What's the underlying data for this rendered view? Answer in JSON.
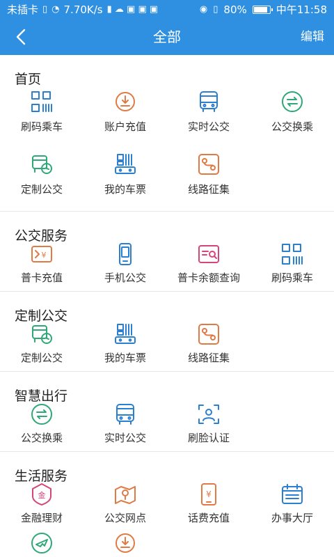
{
  "status": {
    "carrier": "未插卡",
    "speed": "7.70K/s",
    "battery": "80%",
    "time": "中午11:58"
  },
  "header": {
    "title": "全部",
    "edit": "编辑"
  },
  "sections": [
    {
      "title": "首页",
      "items": [
        {
          "label": "刷码乘车",
          "icon": "qr-scan-icon"
        },
        {
          "label": "账户充值",
          "icon": "download-coin-icon"
        },
        {
          "label": "实时公交",
          "icon": "bus-icon"
        },
        {
          "label": "公交换乘",
          "icon": "transfer-icon"
        },
        {
          "label": "定制公交",
          "icon": "custom-bus-icon"
        },
        {
          "label": "我的车票",
          "icon": "ticket-icon"
        },
        {
          "label": "线路征集",
          "icon": "route-map-icon"
        }
      ]
    },
    {
      "title": "公交服务",
      "items": [
        {
          "label": "普卡充值",
          "icon": "card-recharge-icon"
        },
        {
          "label": "手机公交",
          "icon": "phone-icon"
        },
        {
          "label": "普卡余额查询",
          "icon": "balance-query-icon"
        },
        {
          "label": "刷码乘车",
          "icon": "qr-scan-icon"
        }
      ]
    },
    {
      "title": "定制公交",
      "items": [
        {
          "label": "定制公交",
          "icon": "custom-bus-icon"
        },
        {
          "label": "我的车票",
          "icon": "ticket-icon"
        },
        {
          "label": "线路征集",
          "icon": "route-map-icon"
        }
      ]
    },
    {
      "title": "智慧出行",
      "items": [
        {
          "label": "公交换乘",
          "icon": "transfer-icon"
        },
        {
          "label": "实时公交",
          "icon": "bus-icon"
        },
        {
          "label": "刷脸认证",
          "icon": "face-id-icon"
        }
      ]
    },
    {
      "title": "生活服务",
      "items": [
        {
          "label": "金融理财",
          "icon": "finance-icon"
        },
        {
          "label": "公交网点",
          "icon": "location-map-icon"
        },
        {
          "label": "话费充值",
          "icon": "phone-bill-icon"
        },
        {
          "label": "办事大厅",
          "icon": "calendar-hall-icon"
        },
        {
          "label": "",
          "icon": "airplane-icon"
        },
        {
          "label": "",
          "icon": "download-coin-icon"
        }
      ]
    }
  ],
  "colors": {
    "primary": "#2f8fe0",
    "blue": "#2b7fd0",
    "green": "#2fa878",
    "orange": "#e07a45",
    "pink": "#d6457a"
  }
}
